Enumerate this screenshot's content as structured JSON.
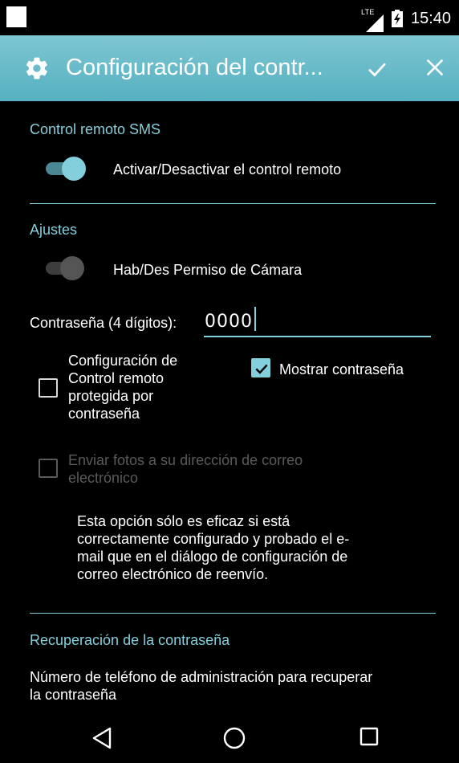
{
  "status_bar": {
    "network_label": "LTE",
    "time": "15:40"
  },
  "app_bar": {
    "title": "Configuración del contr...",
    "icon": "gear-icon",
    "confirm_icon": "checkmark-icon",
    "close_icon": "close-icon",
    "background_color": "#5fb6c5"
  },
  "sections": {
    "sms": {
      "header": "Control remoto SMS",
      "toggle_label": "Activar/Desactivar el control remoto",
      "toggle_on": true
    },
    "settings": {
      "header": "Ajustes",
      "camera_label": "Hab/Des Permiso de Cámara",
      "camera_on": false,
      "password_label": "Contraseña (4 dígitos):",
      "password_value": "0000",
      "protected_lines": [
        "Configuración de",
        "Control remoto",
        "protegida por",
        "contraseña"
      ],
      "protected_checked": false,
      "show_password_label": "Mostrar contraseña",
      "show_password_checked": true,
      "email_lines": [
        "Enviar fotos a su dirección de correo",
        "electrónico"
      ],
      "email_checked": false,
      "email_disabled": true,
      "info_lines": [
        "Esta opción sólo es eficaz si está",
        "correctamente configurado y probado el e-",
        "mail que en el diálogo de configuración de",
        "correo electrónico de reenvío."
      ]
    },
    "recovery": {
      "header": "Recuperación de la contraseña",
      "description_lines": [
        "Número de teléfono de administración para recuperar",
        "la contraseña"
      ]
    }
  },
  "nav_bar": {
    "back_icon": "back-triangle-icon",
    "home_icon": "home-circle-icon",
    "recents_icon": "recents-square-icon"
  },
  "colors": {
    "accent": "#83cfdc",
    "background": "#000000",
    "disabled": "#5a5a5a"
  }
}
